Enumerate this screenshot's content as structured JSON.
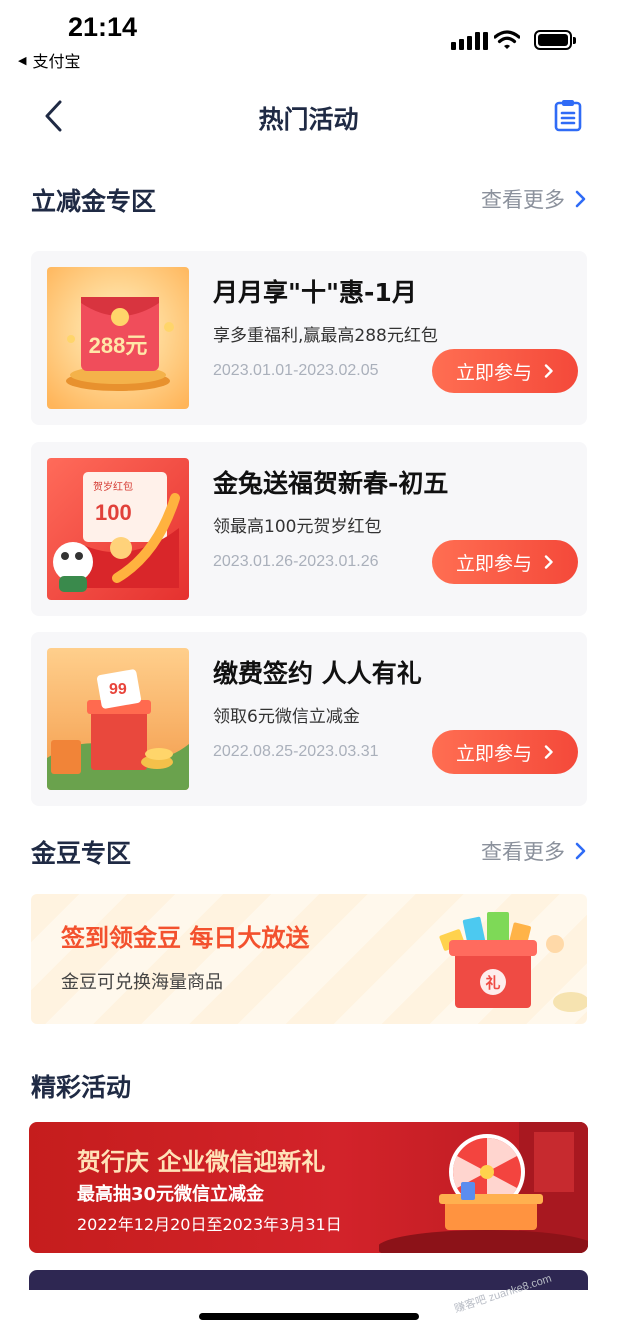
{
  "status_bar": {
    "time": "21:14",
    "back_app": "支付宝",
    "icons": [
      "signal-icon",
      "wifi-icon",
      "battery-icon"
    ]
  },
  "nav": {
    "title": "热门活动",
    "back_icon": "chevron-left-icon",
    "right_icon": "clipboard-icon"
  },
  "sections": {
    "discount": {
      "title": "立减金专区",
      "more": "查看更多"
    },
    "beans": {
      "title": "金豆专区",
      "more": "查看更多"
    },
    "featured": {
      "title": "精彩活动"
    }
  },
  "activities": [
    {
      "title": "月月享\"十\"惠-1月",
      "desc": "享多重福利,赢最高288元红包",
      "date": "2023.01.01-2023.02.05",
      "button": "立即参与",
      "thumb_text": "288元"
    },
    {
      "title": "金兔送福贺新春-初五",
      "desc": "领最高100元贺岁红包",
      "date": "2023.01.26-2023.01.26",
      "button": "立即参与",
      "thumb_text": "100",
      "thumb_label": "贺岁红包"
    },
    {
      "title": "缴费签约 人人有礼",
      "desc": "领取6元微信立减金",
      "date": "2022.08.25-2023.03.31",
      "button": "立即参与",
      "thumb_text": "99"
    }
  ],
  "bean_banner": {
    "title": "签到领金豆  每日大放送",
    "subtitle": "金豆可兑换海量商品",
    "gift_char": "礼"
  },
  "featured_banner": {
    "title": "贺行庆 企业微信迎新礼",
    "subtitle": "最高抽30元微信立减金",
    "date": "2022年12月20日至2023年3月31日"
  },
  "watermark": "赚客吧 zuanke8.com",
  "colors": {
    "primary_text": "#1f2a44",
    "accent_blue": "#2f6bf6",
    "button_red": "#f4493a",
    "muted": "#8b919c"
  }
}
